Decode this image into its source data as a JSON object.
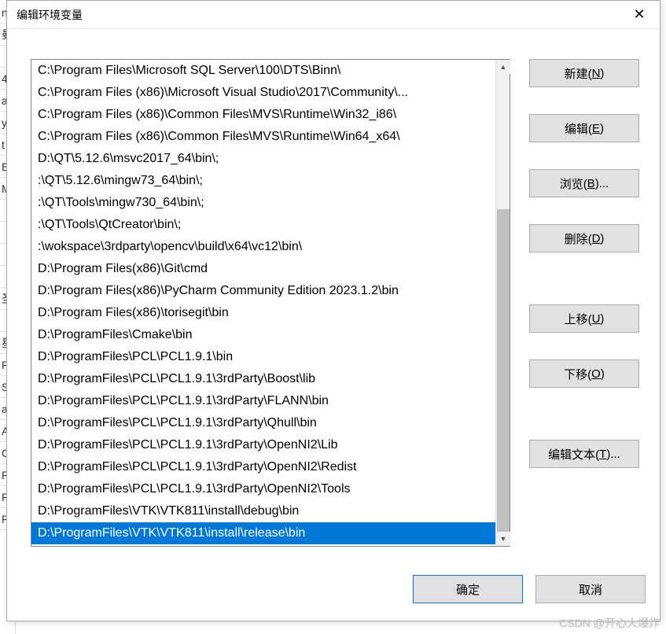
{
  "bg_rows": [
    "n",
    "曼",
    "",
    "4",
    "a",
    "y",
    "t",
    "EI",
    "M",
    "",
    "",
    "",
    "",
    "圣",
    "",
    "星",
    "P",
    "S",
    "a",
    "A",
    "C",
    "R",
    "R",
    "R"
  ],
  "dialog": {
    "title": "编辑环境变量",
    "close_label": "✕"
  },
  "list": {
    "items": [
      "C:\\Program Files\\Microsoft SQL Server\\100\\DTS\\Binn\\",
      "C:\\Program Files (x86)\\Microsoft Visual Studio\\2017\\Community\\...",
      "C:\\Program Files (x86)\\Common Files\\MVS\\Runtime\\Win32_i86\\",
      "C:\\Program Files (x86)\\Common Files\\MVS\\Runtime\\Win64_x64\\",
      "D:\\QT\\5.12.6\\msvc2017_64\\bin\\;",
      ":\\QT\\5.12.6\\mingw73_64\\bin\\;",
      ":\\QT\\Tools\\mingw730_64\\bin\\;",
      ":\\QT\\Tools\\QtCreator\\bin\\;",
      ":\\wokspace\\3rdparty\\opencv\\build\\x64\\vc12\\bin\\",
      "D:\\Program Files(x86)\\Git\\cmd",
      "D:\\Program Files(x86)\\PyCharm Community Edition 2023.1.2\\bin",
      "D:\\Program Files(x86)\\torisegit\\bin",
      "D:\\ProgramFiles\\Cmake\\bin",
      "D:\\ProgramFiles\\PCL\\PCL1.9.1\\bin",
      "D:\\ProgramFiles\\PCL\\PCL1.9.1\\3rdParty\\Boost\\lib",
      "D:\\ProgramFiles\\PCL\\PCL1.9.1\\3rdParty\\FLANN\\bin",
      "D:\\ProgramFiles\\PCL\\PCL1.9.1\\3rdParty\\Qhull\\bin",
      "D:\\ProgramFiles\\PCL\\PCL1.9.1\\3rdParty\\OpenNI2\\Lib",
      "D:\\ProgramFiles\\PCL\\PCL1.9.1\\3rdParty\\OpenNI2\\Redist",
      "D:\\ProgramFiles\\PCL\\PCL1.9.1\\3rdParty\\OpenNI2\\Tools",
      "D:\\ProgramFiles\\VTK\\VTK811\\install\\debug\\bin",
      "D:\\ProgramFiles\\VTK\\VTK811\\install\\release\\bin"
    ],
    "selected_index": 21
  },
  "buttons": {
    "new": {
      "text": "新建(",
      "key": "N",
      "suffix": ")"
    },
    "edit": {
      "text": "编辑(",
      "key": "E",
      "suffix": ")"
    },
    "browse": {
      "text": "浏览(",
      "key": "B",
      "suffix": ")..."
    },
    "delete": {
      "text": "删除(",
      "key": "D",
      "suffix": ")"
    },
    "up": {
      "text": "上移(",
      "key": "U",
      "suffix": ")"
    },
    "down": {
      "text": "下移(",
      "key": "O",
      "suffix": ")"
    },
    "edit_text": {
      "text": "编辑文本(",
      "key": "T",
      "suffix": ")..."
    },
    "ok": "确定",
    "cancel": "取消"
  },
  "scroll": {
    "up_glyph": "▲",
    "down_glyph": "▼"
  },
  "watermark": "CSDN @开心大爆炸"
}
